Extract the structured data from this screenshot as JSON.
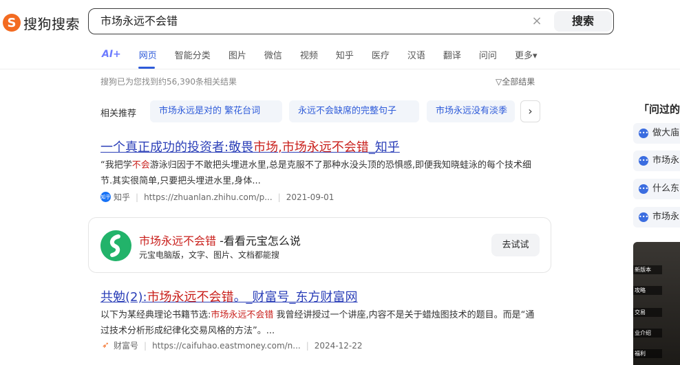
{
  "header": {
    "logo_text": "搜狗搜索",
    "search_value": "市场永远不会错",
    "clear_symbol": "×",
    "search_button": "搜索"
  },
  "tabs": {
    "ai": "AI+",
    "items": [
      "网页",
      "智能分类",
      "图片",
      "微信",
      "视频",
      "知乎",
      "医疗",
      "汉语",
      "翻译",
      "问问",
      "更多▾"
    ],
    "active_index": 0
  },
  "results_info": {
    "count_text": "搜狗已为您找到约56,390条相关结果",
    "all_results": "▽全部结果"
  },
  "related": {
    "label": "相关推荐",
    "chips": [
      "市场永远是对的 繁花台词",
      "永远不会缺席的完整句子",
      "市场永远没有淡季"
    ],
    "next_symbol": "›"
  },
  "results": [
    {
      "title_parts": [
        "一个真正成功的投资者:敬畏",
        "市场",
        ",",
        "市场永远不会错",
        "_知乎"
      ],
      "snippet_parts": [
        "“我把学",
        "不会",
        "游泳归因于不敢把头埋进水里,总是克服不了那种水没头顶的恐惧感,即便我知晓蛙泳的每个技术细节.其实很简单,只要把头埋进水里,身体..."
      ],
      "source_icon": "知乎",
      "source": "知乎",
      "url": "https://zhuanlan.zhihu.com/p...",
      "date": "2021-09-01"
    },
    {
      "title_parts": [
        "共勉(2):",
        "市场永远不会错",
        "。_财富号_东方财富网"
      ],
      "snippet_parts": [
        "以下为某经典理论书籍节选:",
        "市场永远不会错",
        " 我曾经讲授过一个讲座,内容不是关于蜡烛图技术的题目。而是“通过技术分析形成纪律化交易风格的方法”。..."
      ],
      "source": "财富号",
      "url": "https://caifuhao.eastmoney.com/n...",
      "date": "2024-12-22"
    }
  ],
  "yuanbao": {
    "title_em": "市场永远不会错",
    "title_rest": " -看看元宝怎么说",
    "subtitle": "元宝电脑版，文字、图片、文档都能搜",
    "button": "去试试"
  },
  "right": {
    "title": "「问过的",
    "questions": [
      "做大庙",
      "市场永",
      "什么东",
      "市场永"
    ],
    "thumb_labels": [
      "新版本",
      "攻略",
      "交易",
      "业介绍",
      "福利"
    ]
  }
}
